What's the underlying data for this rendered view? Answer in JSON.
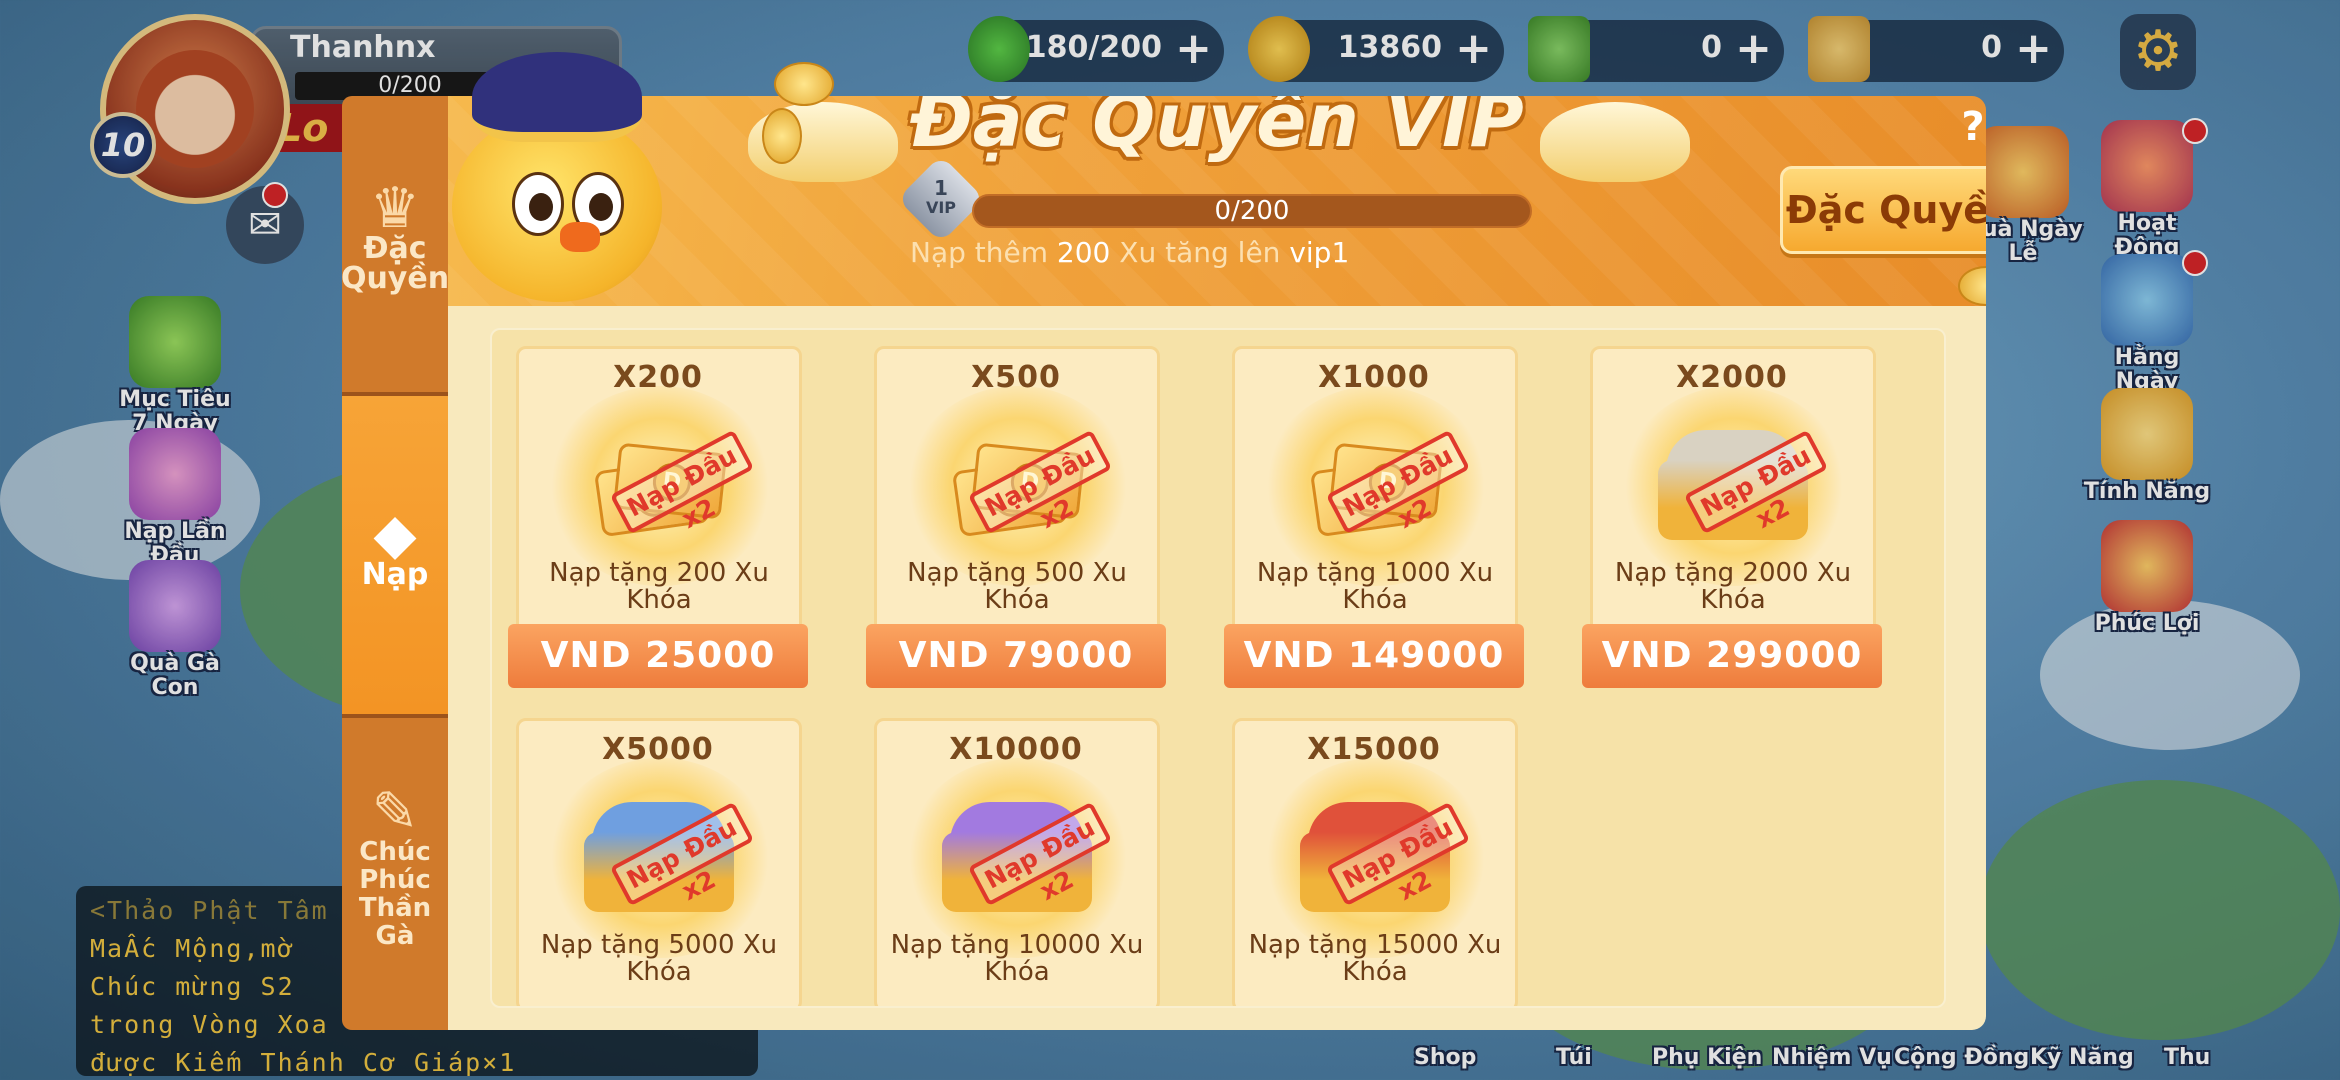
{
  "hud": {
    "player_name": "Thanhnx",
    "exp_text": "0/200",
    "level": "10",
    "lock_text": "Lo",
    "energy": "180/200",
    "gold": "13860",
    "cash1": "0",
    "cash2": "0"
  },
  "left_side": [
    {
      "label": "Mục Tiêu 7 Ngày"
    },
    {
      "label": "Nạp Lần Đầu"
    },
    {
      "label": "Quà Gà Con"
    }
  ],
  "right_side": [
    {
      "label": "Quà Ngày Lễ"
    },
    {
      "label": "Hoạt Động"
    },
    {
      "label": "Hằng Ngày"
    },
    {
      "label": "Tính Năng"
    },
    {
      "label": "Phúc Lợi"
    }
  ],
  "chat": {
    "lines": [
      "<Thảo Phật Tâm",
      "MaẤc Mộng,mờ",
      "Chúc mừng S2",
      "trong Vòng Xoa",
      "được Kiếm Thánh Cơ Giáp×1"
    ]
  },
  "bottom_nav": [
    "Shop",
    "Túi",
    "Phụ Kiện",
    "Nhiệm Vụ",
    "Cộng Đồng",
    "Kỹ Năng",
    "Thu"
  ],
  "dialog": {
    "title": "Đặc Quyền VIP",
    "help": "?",
    "close": "✕",
    "tabs": [
      {
        "label": "Đặc Quyền",
        "icon": "crown-icon"
      },
      {
        "label": "Nạp",
        "icon": "gem-plus-icon"
      },
      {
        "label": "Chúc Phúc Thần Gà",
        "icon": "scroll-icon"
      }
    ],
    "vip_badge": "VIP",
    "vip_badge_level": "1",
    "vip_progress_text": "0/200",
    "vip_progress": 0,
    "vip_note_prefix": "Nạp thêm",
    "vip_note_amount": "200",
    "vip_note_mid": "Xu tăng lên",
    "vip_note_target": "vip1",
    "privilege_button": "Đặc Quyền"
  },
  "stamp_text": "Nạp Đầu x2",
  "packs": [
    {
      "qty": "X200",
      "desc": "Nạp tặng 200 Xu Khóa",
      "price": "VND 25000",
      "art": "cash",
      "chest_color": ""
    },
    {
      "qty": "X500",
      "desc": "Nạp tặng 500 Xu Khóa",
      "price": "VND 79000",
      "art": "cash",
      "chest_color": ""
    },
    {
      "qty": "X1000",
      "desc": "Nạp tặng 1000 Xu Khóa",
      "price": "VND 149000",
      "art": "cash",
      "chest_color": ""
    },
    {
      "qty": "X2000",
      "desc": "Nạp tặng 2000 Xu Khóa",
      "price": "VND 299000",
      "art": "chest",
      "chest_color": "#d9d2c2"
    },
    {
      "qty": "X5000",
      "desc": "Nạp tặng 5000 Xu Khóa",
      "price": "",
      "art": "chest",
      "chest_color": "#6f9fe0"
    },
    {
      "qty": "X10000",
      "desc": "Nạp tặng 10000 Xu Khóa",
      "price": "",
      "art": "chest",
      "chest_color": "#a27ae0"
    },
    {
      "qty": "X15000",
      "desc": "Nạp tặng 15000 Xu Khóa",
      "price": "",
      "art": "chest",
      "chest_color": "#e0513a"
    }
  ]
}
